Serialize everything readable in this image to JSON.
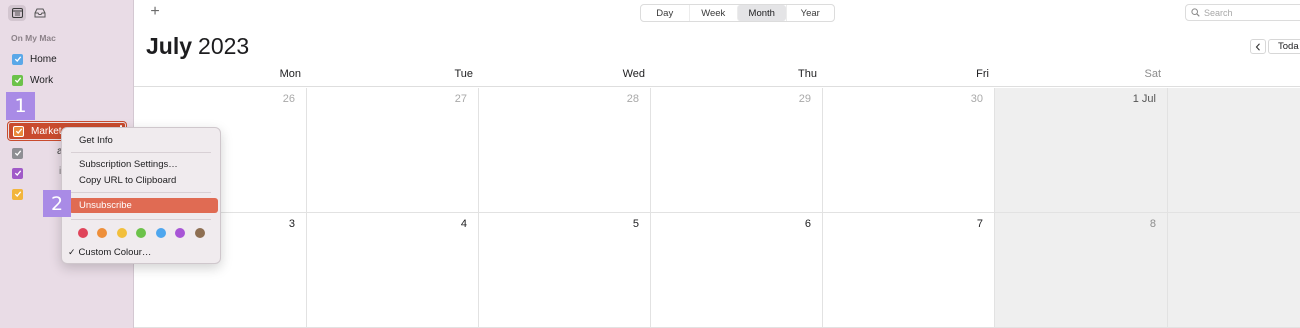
{
  "toolbar": {
    "add_label": "+",
    "views": [
      "Day",
      "Week",
      "Month",
      "Year"
    ],
    "active_view": "Month",
    "search_placeholder": "Search"
  },
  "header": {
    "month": "July",
    "year": "2023",
    "today_label": "Toda"
  },
  "sidebar": {
    "section": "On My Mac",
    "calendars": [
      {
        "label": "Home",
        "color": "#5aa8e8"
      },
      {
        "label": "Work",
        "color": "#6cc24a"
      },
      {
        "label": "Market",
        "color": "#e98a3a"
      },
      {
        "label": "",
        "color": "#8e8e93"
      },
      {
        "label": "",
        "color": "#a05ac8"
      },
      {
        "label": "",
        "color": "#f2b53c"
      }
    ],
    "fragments": [
      "a",
      "i"
    ]
  },
  "badges": [
    "1",
    "2"
  ],
  "weekdays": [
    "Mon",
    "Tue",
    "Wed",
    "Thu",
    "Fri",
    "Sat"
  ],
  "weeks": [
    [
      "26",
      "27",
      "28",
      "29",
      "30",
      "1 Jul",
      ""
    ],
    [
      "3",
      "4",
      "5",
      "6",
      "7",
      "8",
      ""
    ]
  ],
  "context_menu": {
    "get_info": "Get Info",
    "subscription_settings": "Subscription Settings…",
    "copy_url": "Copy URL to Clipboard",
    "unsubscribe": "Unsubscribe",
    "colors": [
      "#e0445a",
      "#ee8f3a",
      "#f2bf3c",
      "#6cc24a",
      "#4ea6ee",
      "#a855d6",
      "#8e6f52"
    ],
    "custom_colour": "Custom Colour…",
    "check": "✓"
  }
}
